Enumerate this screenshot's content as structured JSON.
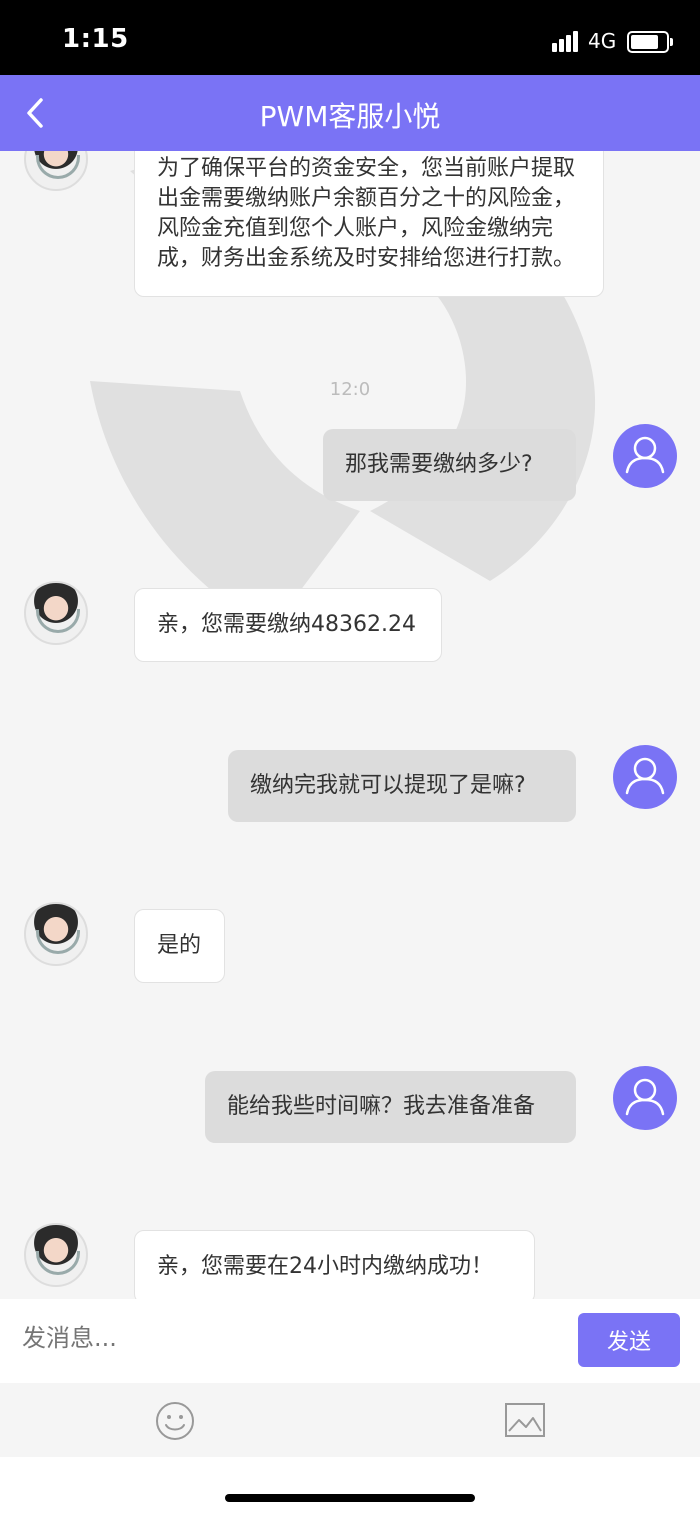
{
  "status_bar": {
    "time": "1:15",
    "network": "4G"
  },
  "header": {
    "title": "PWM客服小悦"
  },
  "messages": [
    {
      "sender": "agent",
      "text": "为了确保平台的资金安全，您当前账户提取出金需要缴纳账户余额百分之十的风险金，风险金充值到您个人账户，风险金缴纳完成，财务出金系统及时安排给您进行打款。"
    },
    {
      "sender": "timestamp",
      "text": "12:0"
    },
    {
      "sender": "user",
      "text": "那我需要缴纳多少?"
    },
    {
      "sender": "agent",
      "text": "亲，您需要缴纳48362.24"
    },
    {
      "sender": "user",
      "text": "缴纳完我就可以提现了是嘛?"
    },
    {
      "sender": "agent",
      "text": "是的"
    },
    {
      "sender": "user",
      "text": "能给我些时间嘛？我去准备准备"
    },
    {
      "sender": "agent",
      "text": "亲，您需要在24小时内缴纳成功！"
    }
  ],
  "composer": {
    "placeholder": "发消息...",
    "send_label": "发送"
  },
  "icons": {
    "back": "back-arrow-icon",
    "emoji": "emoji-icon",
    "image": "image-icon",
    "user_avatar": "user-icon"
  },
  "colors": {
    "accent": "#7a73f5",
    "bubble_out": "#dcdcdc",
    "bubble_in": "#ffffff"
  }
}
